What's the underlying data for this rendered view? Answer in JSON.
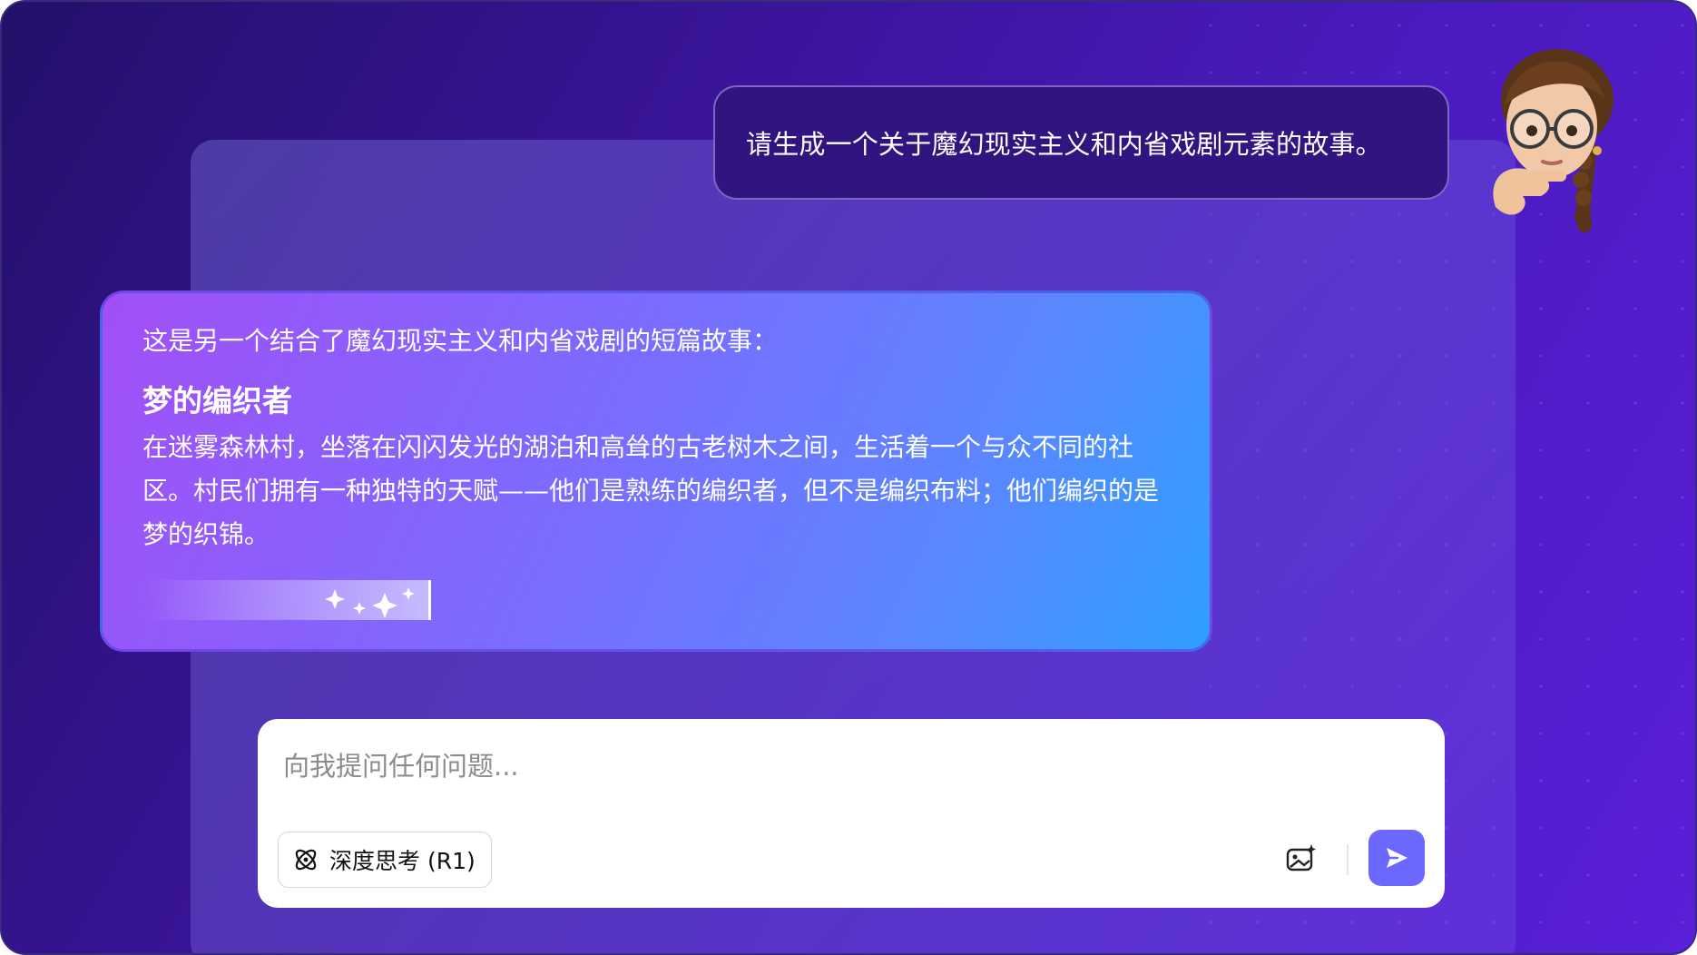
{
  "user_message": "请生成一个关于魔幻现实主义和内省戏剧元素的故事。",
  "assistant": {
    "intro": "这是另一个结合了魔幻现实主义和内省戏剧的短篇故事：",
    "story_title": "梦的编织者",
    "story_body": "在迷雾森林村，坐落在闪闪发光的湖泊和高耸的古老树木之间，生活着一个与众不同的社区。村民们拥有一种独特的天赋——他们是熟练的编织者，但不是编织布料；他们编织的是梦的织锦。",
    "loading_icon": "sparkles-icon"
  },
  "composer": {
    "placeholder": "向我提问任何问题...",
    "deep_think_label": "深度思考 (R1)",
    "deep_think_icon": "atom-icon",
    "image_icon": "image-sparkle-icon",
    "send_icon": "send-icon"
  },
  "colors": {
    "background_start": "#24106a",
    "background_end": "#5a1fd8",
    "user_bubble": "#311480",
    "assistant_gradient_start": "#a24ff7",
    "assistant_gradient_end": "#2f9fff",
    "send_button": "#6b67ff"
  }
}
